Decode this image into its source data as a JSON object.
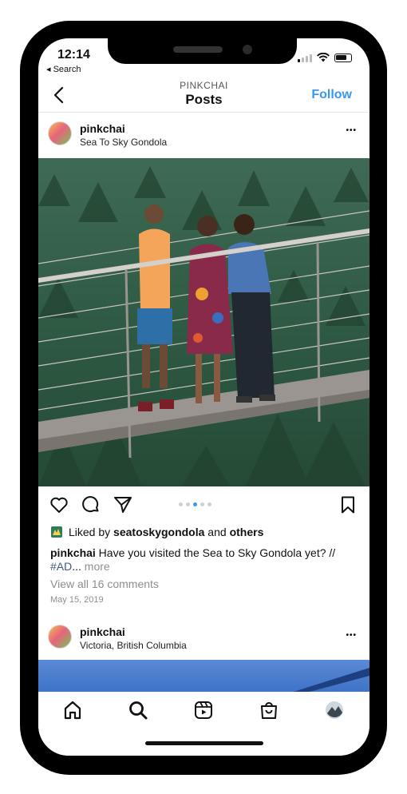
{
  "status_bar": {
    "time": "12:14",
    "back_app": "◂ Search"
  },
  "header": {
    "username": "PINKCHAI",
    "title": "Posts",
    "follow_label": "Follow"
  },
  "post": {
    "username": "pinkchai",
    "location": "Sea To Sky Gondola",
    "more_label": "•••",
    "carousel": {
      "count": 5,
      "active_index": 2
    },
    "liked_prefix": "Liked by ",
    "liked_user": "seatoskygondola",
    "liked_and": " and ",
    "liked_others": "others",
    "caption_user": "pinkchai",
    "caption_text": " Have you visited the Sea to Sky Gondola yet? //",
    "caption_hashtag": "#AD",
    "caption_ellipsis": "...",
    "caption_more": " more",
    "comments_link": "View all 16 comments",
    "date": "May 15, 2019"
  },
  "next_post": {
    "username": "pinkchai",
    "location": "Victoria, British Columbia",
    "more_label": "•••"
  },
  "bottom_nav": {
    "items": [
      "home-icon",
      "search-icon",
      "reels-icon",
      "shop-icon",
      "profile-avatar"
    ]
  },
  "colors": {
    "accent": "#3897f0",
    "hashtag": "#3b5b85",
    "secondary_text": "#8e8e8e"
  }
}
